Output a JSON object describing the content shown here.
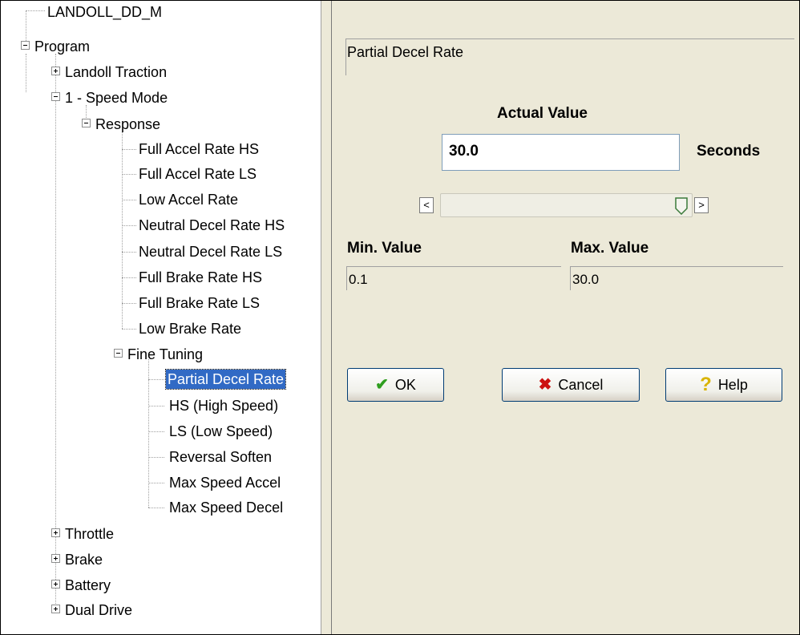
{
  "tree": {
    "root": "LANDOLL_DD_M",
    "program": "Program",
    "landoll_traction": "Landoll Traction",
    "speed_mode": "1 - Speed Mode",
    "response": "Response",
    "response_items": [
      "Full Accel Rate HS",
      "Full Accel Rate LS",
      "Low Accel Rate",
      "Neutral Decel Rate HS",
      "Neutral Decel Rate LS",
      "Full Brake Rate HS",
      "Full Brake Rate LS",
      "Low Brake Rate"
    ],
    "fine_tuning": "Fine Tuning",
    "fine_tuning_items": [
      "Partial Decel Rate",
      "HS (High Speed)",
      "LS (Low Speed)",
      "Reversal Soften",
      "Max Speed Accel",
      "Max Speed Decel"
    ],
    "selected": "Partial Decel Rate",
    "throttle": "Throttle",
    "brake": "Brake",
    "battery": "Battery",
    "dual_drive": "Dual Drive"
  },
  "editor": {
    "parameter_name": "Partial Decel Rate",
    "actual_value_label": "Actual Value",
    "actual_value": "30.0",
    "units": "Seconds",
    "slider_fraction": 1.0,
    "scroll_left_glyph": "<",
    "scroll_right_glyph": ">",
    "min_label": "Min. Value",
    "min_value": "0.1",
    "max_label": "Max. Value",
    "max_value": "30.0"
  },
  "buttons": {
    "ok": "OK",
    "cancel": "Cancel",
    "help": "Help"
  },
  "icons": {
    "ok": "checkmark-icon",
    "cancel": "x-icon",
    "help": "question-icon"
  },
  "colors": {
    "selection": "#316ac5",
    "panel_bg": "#ece9d8",
    "ok_icon": "#2f9e1f",
    "cancel_icon": "#cc1111",
    "help_icon": "#d9b400"
  }
}
